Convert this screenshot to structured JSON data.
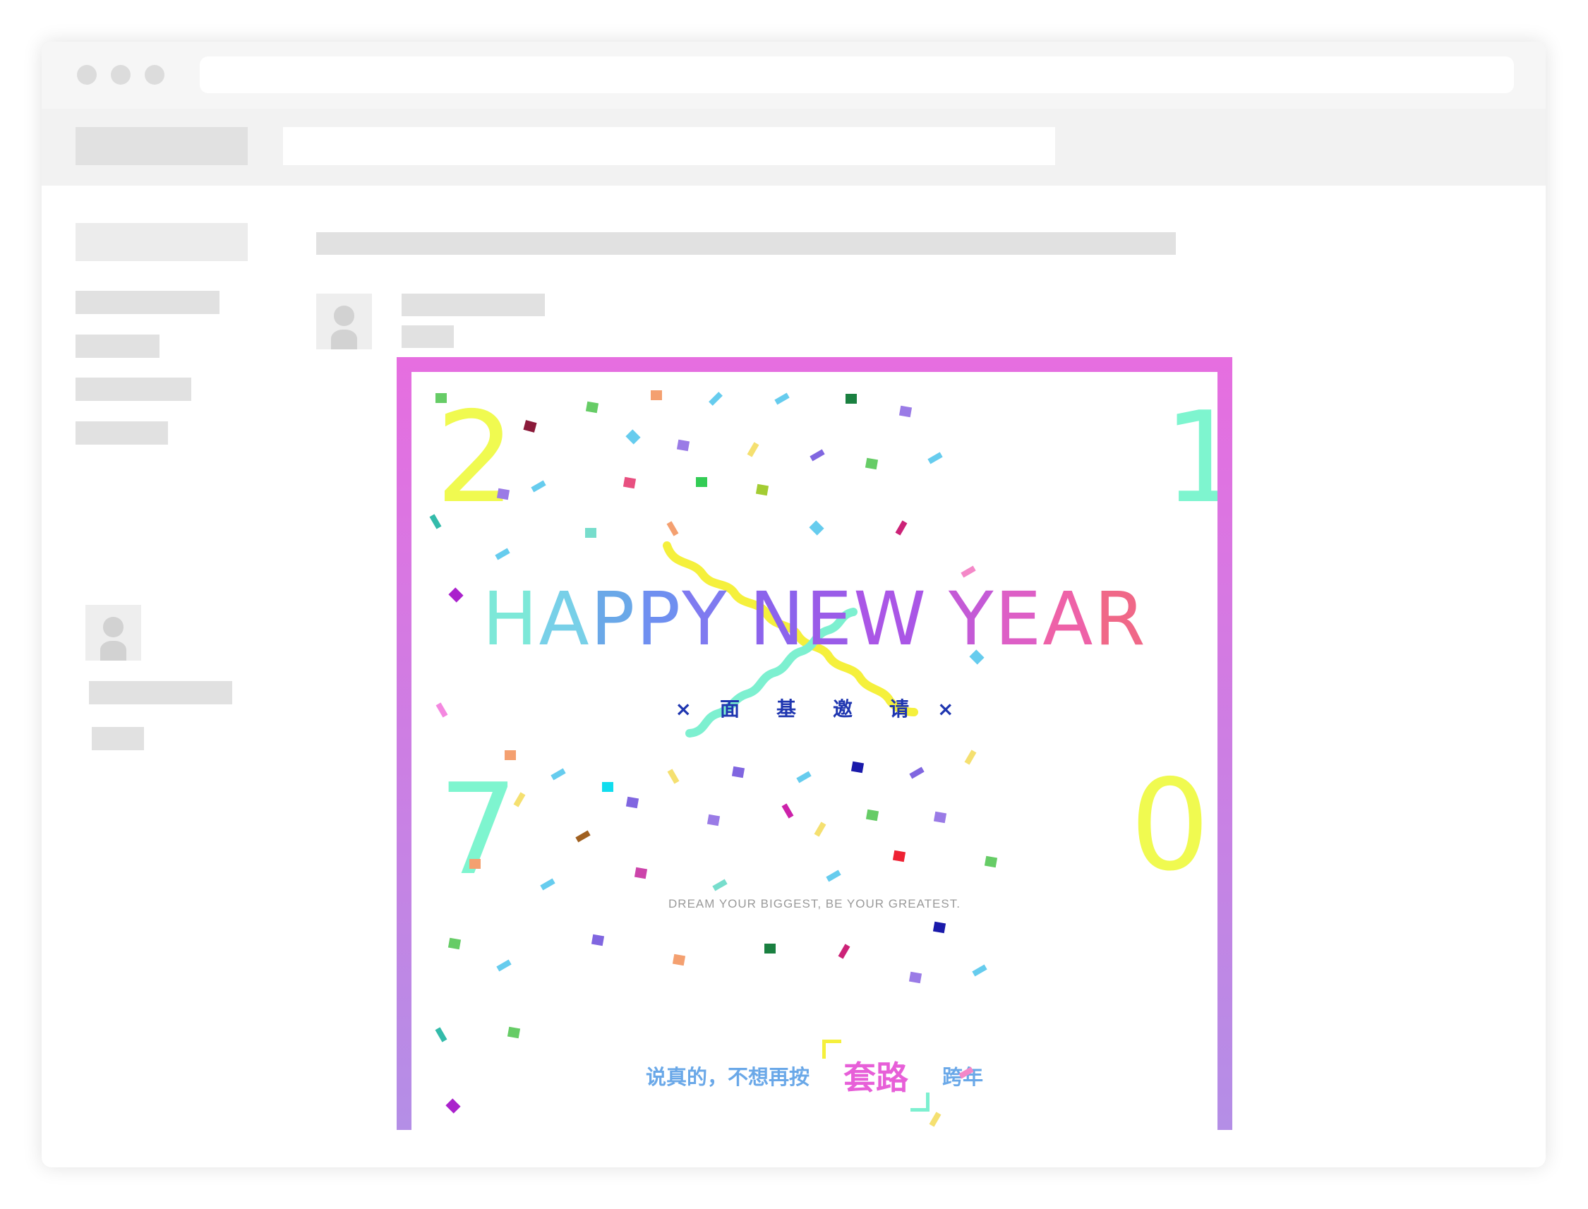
{
  "email": {
    "digits": [
      "2",
      "1",
      "7",
      "0"
    ],
    "title_letters": [
      "H",
      "A",
      "P",
      "P",
      "Y",
      " ",
      "N",
      "E",
      "W",
      " ",
      "Y",
      "E",
      "A",
      "R"
    ],
    "title_colors": [
      "#7de8d8",
      "#78d0e8",
      "#6aa8e8",
      "#6f8ff0",
      "#7f7af0",
      "#ffffff",
      "#8c63ec",
      "#9a5ce8",
      "#aa56e6",
      "#ffffff",
      "#c45ad6",
      "#dd5fc6",
      "#ee62a8",
      "#f06888"
    ],
    "subtitle_x": "×",
    "subtitle_chars": [
      "面",
      "基",
      "邀",
      "请"
    ],
    "tagline": "DREAM YOUR BIGGEST, BE YOUR GREATEST.",
    "bottom_pre": "说真的，不想再按",
    "bottom_highlight": "套路",
    "bottom_post": "跨年"
  },
  "colors": {
    "border_top": "#e66ee0",
    "border_bottom": "#b48ee6",
    "digit_yellow": "#f0fa50",
    "digit_mint": "#7ef5cf",
    "subtitle_blue": "#1f36b0",
    "squiggle_yellow": "#f5f03c",
    "squiggle_mint": "#7df0d0"
  },
  "icons": [
    "window-dot",
    "avatar-icon"
  ]
}
